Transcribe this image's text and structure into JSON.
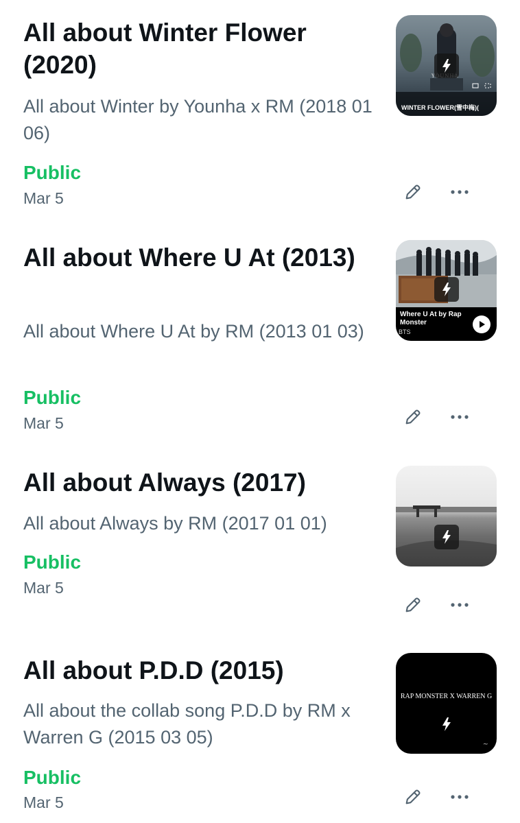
{
  "moments": [
    {
      "title": "All about Winter Flower (2020)",
      "description": "All about Winter by Younha x RM (2018 01 06)",
      "visibility": "Public",
      "date": "Mar 5",
      "thumbnail": {
        "caption": "WINTER FLOWER(雪中梅)(",
        "small_text": "YOUNHA"
      }
    },
    {
      "title": "All about Where U At (2013)",
      "description": "All about Where U At by RM (2013 01 03)",
      "visibility": "Public",
      "date": "Mar 5",
      "thumbnail": {
        "caption": "Where U At by Rap Monster",
        "sub": "BTS"
      }
    },
    {
      "title": "All about Always (2017)",
      "description": "All about Always by RM (2017 01 01)",
      "visibility": "Public",
      "date": "Mar 5",
      "thumbnail": {}
    },
    {
      "title": "All about P.D.D (2015)",
      "description": "All about the collab song P.D.D by RM x Warren G (2015 03 05)",
      "visibility": "Public",
      "date": "Mar 5",
      "thumbnail": {
        "caption": "RAP MONSTER  X  WARREN G"
      }
    }
  ],
  "icons": {
    "edit": "pencil-icon",
    "more": "more-icon",
    "moment": "lightning-bolt-icon",
    "play": "play-icon"
  },
  "colors": {
    "public": "#17bf63",
    "secondary_text": "#536471",
    "primary_text": "#0f1419"
  }
}
